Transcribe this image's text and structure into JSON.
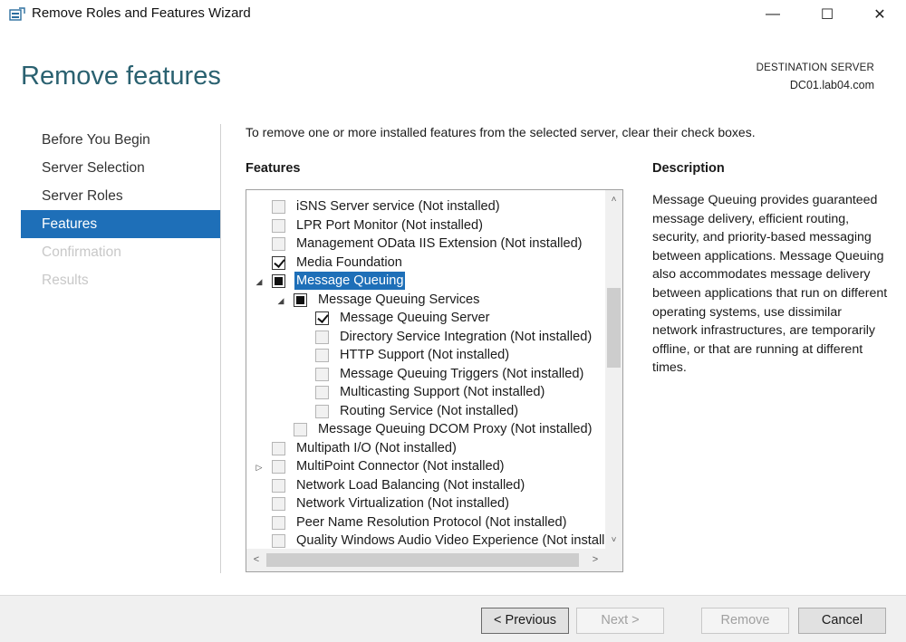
{
  "window": {
    "title": "Remove Roles and Features Wizard",
    "minimize": "—",
    "maximize": "☐",
    "close": "✕"
  },
  "header": {
    "page_title": "Remove features",
    "destination_label": "DESTINATION SERVER",
    "destination_server": "DC01.lab04.com"
  },
  "nav": {
    "items": [
      {
        "label": "Before You Begin",
        "state": "normal"
      },
      {
        "label": "Server Selection",
        "state": "normal"
      },
      {
        "label": "Server Roles",
        "state": "normal"
      },
      {
        "label": "Features",
        "state": "active"
      },
      {
        "label": "Confirmation",
        "state": "disabled"
      },
      {
        "label": "Results",
        "state": "disabled"
      }
    ]
  },
  "main": {
    "instruction": "To remove one or more installed features from the selected server, clear their check boxes.",
    "features_heading": "Features",
    "description_heading": "Description",
    "description_text": "Message Queuing provides guaranteed message delivery, efficient routing, security, and priority-based messaging between applications. Message Queuing also accommodates message delivery between applications that run on different operating systems, use dissimilar network infrastructures, are temporarily offline, or that are running at different times."
  },
  "tree": {
    "items": [
      {
        "label": "iSNS Server service (Not installed)",
        "level": 0,
        "check": "disabled",
        "expander": ""
      },
      {
        "label": "LPR Port Monitor (Not installed)",
        "level": 0,
        "check": "disabled",
        "expander": ""
      },
      {
        "label": "Management OData IIS Extension (Not installed)",
        "level": 0,
        "check": "disabled",
        "expander": ""
      },
      {
        "label": "Media Foundation",
        "level": 0,
        "check": "checked",
        "expander": ""
      },
      {
        "label": "Message Queuing",
        "level": 0,
        "check": "partial",
        "expander": "◢",
        "selected": true
      },
      {
        "label": "Message Queuing Services",
        "level": 1,
        "check": "partial",
        "expander": "◢"
      },
      {
        "label": "Message Queuing Server",
        "level": 2,
        "check": "checked",
        "expander": ""
      },
      {
        "label": "Directory Service Integration (Not installed)",
        "level": 2,
        "check": "disabled",
        "expander": ""
      },
      {
        "label": "HTTP Support (Not installed)",
        "level": 2,
        "check": "disabled",
        "expander": ""
      },
      {
        "label": "Message Queuing Triggers (Not installed)",
        "level": 2,
        "check": "disabled",
        "expander": ""
      },
      {
        "label": "Multicasting Support (Not installed)",
        "level": 2,
        "check": "disabled",
        "expander": ""
      },
      {
        "label": "Routing Service (Not installed)",
        "level": 2,
        "check": "disabled",
        "expander": ""
      },
      {
        "label": "Message Queuing DCOM Proxy (Not installed)",
        "level": 1,
        "check": "disabled",
        "expander": ""
      },
      {
        "label": "Multipath I/O (Not installed)",
        "level": 0,
        "check": "disabled",
        "expander": ""
      },
      {
        "label": "MultiPoint Connector (Not installed)",
        "level": 0,
        "check": "disabled",
        "expander": "▷"
      },
      {
        "label": "Network Load Balancing (Not installed)",
        "level": 0,
        "check": "disabled",
        "expander": ""
      },
      {
        "label": "Network Virtualization (Not installed)",
        "level": 0,
        "check": "disabled",
        "expander": ""
      },
      {
        "label": "Peer Name Resolution Protocol (Not installed)",
        "level": 0,
        "check": "disabled",
        "expander": ""
      },
      {
        "label": "Quality Windows Audio Video Experience (Not installed)",
        "level": 0,
        "check": "disabled",
        "expander": ""
      }
    ],
    "scroll_up": "˄",
    "scroll_down": "˅",
    "scroll_left": "<",
    "scroll_right": ">"
  },
  "footer": {
    "previous": "< Previous",
    "next": "Next >",
    "remove": "Remove",
    "cancel": "Cancel"
  }
}
